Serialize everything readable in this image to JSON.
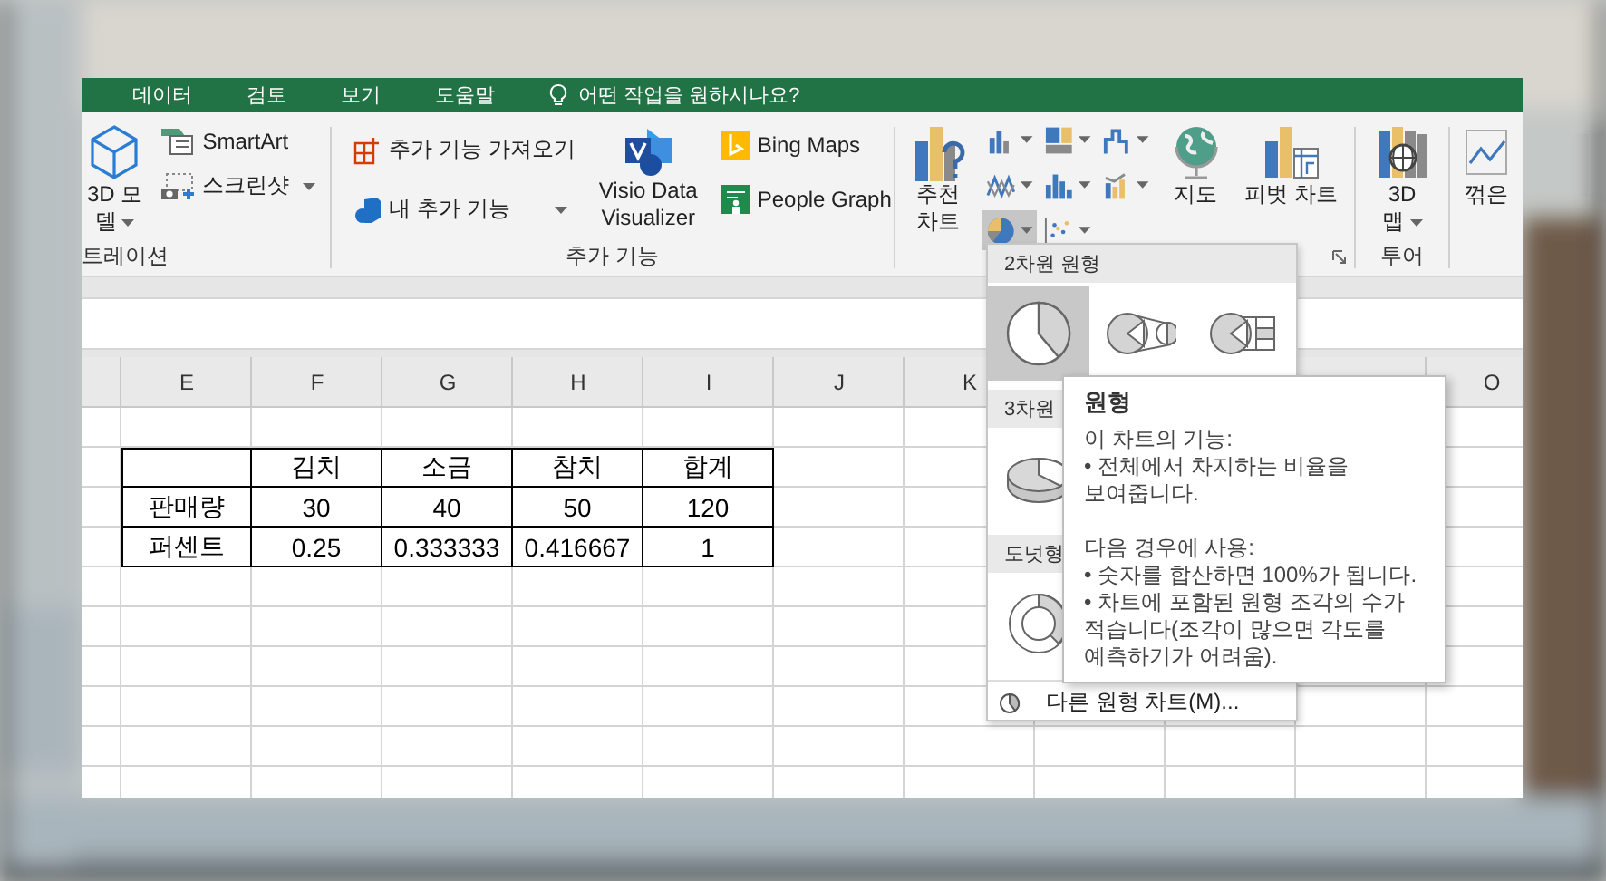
{
  "menu_tabs": [
    {
      "label": "데이터"
    },
    {
      "label": "검토"
    },
    {
      "label": "보기"
    },
    {
      "label": "도움말"
    }
  ],
  "tell_me": {
    "placeholder": "어떤 작업을 원하시나요?"
  },
  "ribbon": {
    "illustrations": {
      "label": "트레이션",
      "model_3d": [
        "3D 모",
        "델"
      ],
      "smartart": "SmartArt",
      "screenshot": "스크린샷"
    },
    "addins": {
      "label": "추가 기능",
      "get_addins": "추가 기능 가져오기",
      "my_addins": "내 추가 기능",
      "visio": [
        "Visio Data",
        "Visualizer"
      ],
      "bing_maps": "Bing Maps",
      "people_graph": "People Graph"
    },
    "charts": {
      "recommended": [
        "추천",
        "차트"
      ],
      "buttons": [
        {
          "kind": "column",
          "selected": false
        },
        {
          "kind": "hierarchy",
          "selected": false
        },
        {
          "kind": "waterfall",
          "selected": false
        },
        {
          "kind": "line",
          "selected": false
        },
        {
          "kind": "statistic",
          "selected": false
        },
        {
          "kind": "combo",
          "selected": false
        },
        {
          "kind": "pie",
          "selected": true
        },
        {
          "kind": "scatter",
          "selected": false
        }
      ],
      "maps": "지도",
      "pivot_chart": "피벗 차트"
    },
    "tours": {
      "label": "투어",
      "map_3d": [
        "3D",
        "맵"
      ]
    },
    "sparklines": {
      "line": "꺾은"
    }
  },
  "sheet": {
    "column_headers": [
      "E",
      "F",
      "G",
      "H",
      "I",
      "J",
      "K"
    ],
    "right_column_header": "O",
    "data_table": {
      "header": [
        "김치",
        "소금",
        "참치",
        "합계"
      ],
      "rows": [
        {
          "label": "판매량",
          "cells": [
            "30",
            "40",
            "50",
            "120"
          ]
        },
        {
          "label": "퍼센트",
          "cells": [
            "0.25",
            "0.333333",
            "0.416667",
            "1"
          ]
        }
      ]
    }
  },
  "pie_dropdown": {
    "sections": [
      {
        "title": "2차원 원형",
        "items": [
          {
            "kind": "pie",
            "selected": true
          },
          {
            "kind": "pie-of-pie",
            "selected": false
          },
          {
            "kind": "bar-of-pie",
            "selected": false
          }
        ]
      },
      {
        "title": "3차원",
        "items": [
          {
            "kind": "pie-3d",
            "selected": false
          }
        ]
      },
      {
        "title": "도넛형",
        "items": [
          {
            "kind": "donut",
            "selected": false
          }
        ]
      }
    ],
    "more": "다른 원형 차트(M)..."
  },
  "tooltip": {
    "title": "원형",
    "sections": [
      {
        "heading": "이 차트의 기능:",
        "bullets": [
          "• 전체에서 차지하는 비율을 보여줍니다."
        ]
      },
      {
        "heading": "다음 경우에 사용:",
        "bullets": [
          "• 숫자를 합산하면 100%가 됩니다.",
          "• 차트에 포함된 원형 조각의 수가 적습니다(조각이 많으면 각도를 예측하기가 어려움)."
        ]
      }
    ]
  }
}
